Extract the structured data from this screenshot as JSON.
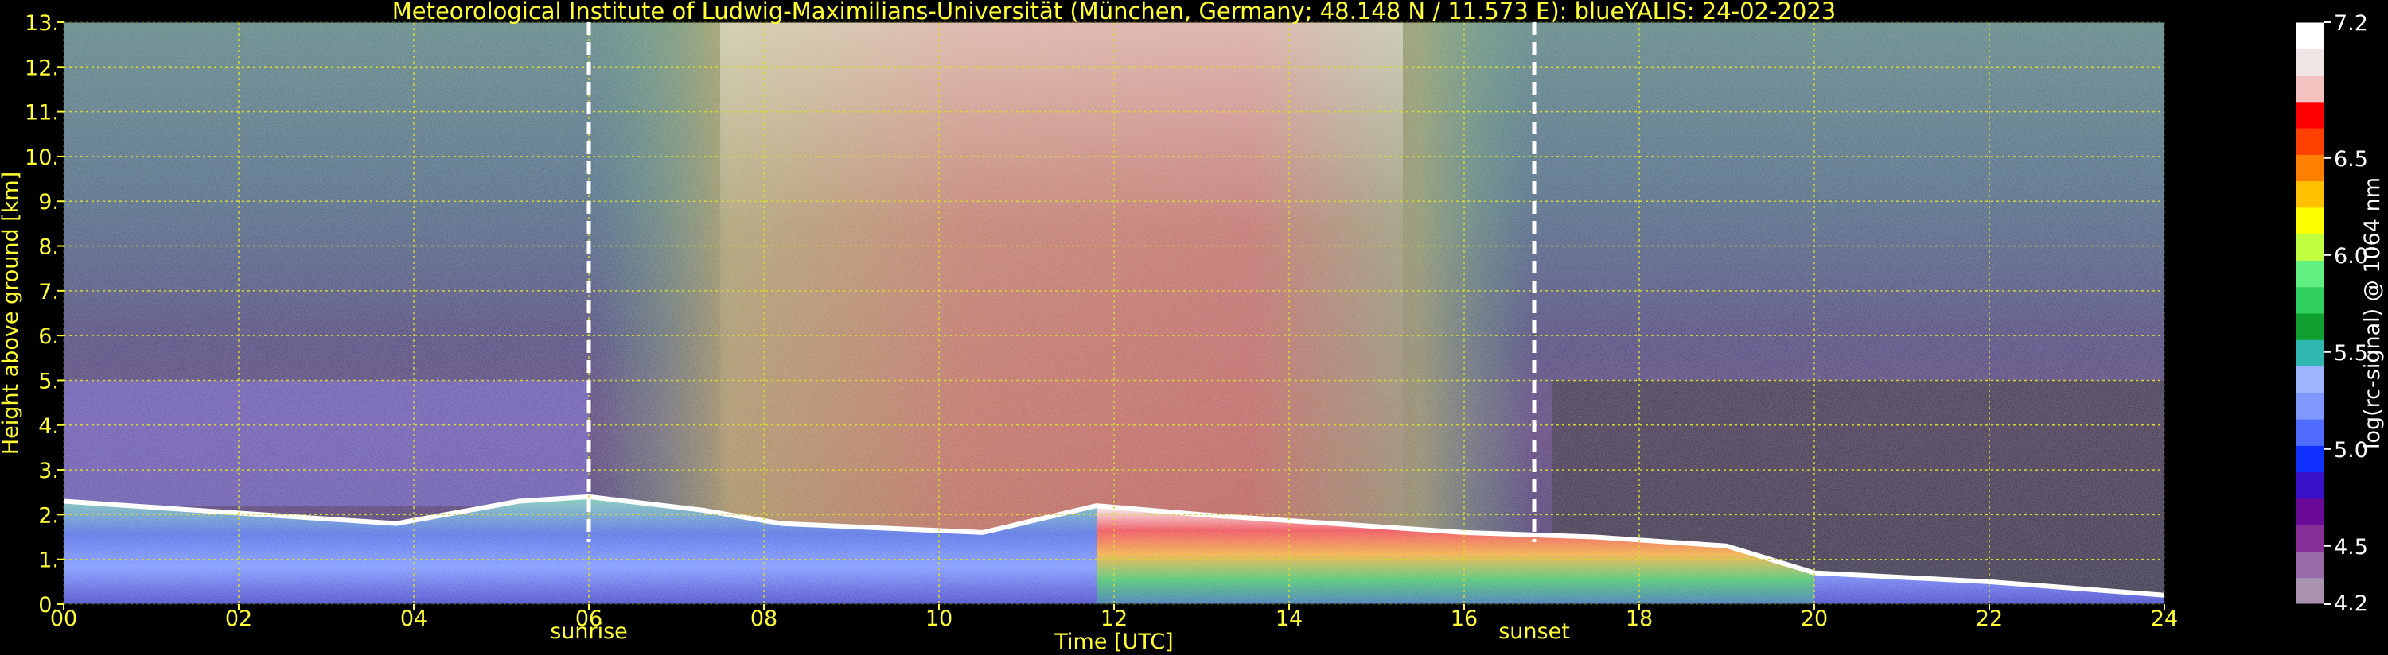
{
  "chart_data": {
    "type": "heatmap",
    "title": "Meteorological Institute of Ludwig-Maximilians-Universität (München, Germany; 48.148 N / 11.573 E):    blueYALIS: 24-02-2023",
    "xlabel": "Time [UTC]",
    "ylabel": "Height above ground [km]",
    "xlim": [
      0,
      24
    ],
    "ylim": [
      0,
      13
    ],
    "x_ticks": [
      0,
      2,
      4,
      6,
      8,
      10,
      12,
      14,
      16,
      18,
      20,
      22,
      24
    ],
    "x_tick_labels": [
      "00",
      "02",
      "04",
      "06",
      "08",
      "10",
      "12",
      "14",
      "16",
      "18",
      "20",
      "22",
      "24"
    ],
    "y_ticks": [
      0,
      1,
      2,
      3,
      4,
      5,
      6,
      7,
      8,
      9,
      10,
      11,
      12,
      13
    ],
    "y_tick_labels": [
      "0.",
      "1.",
      "2.",
      "3.",
      "4.",
      "5.",
      "6.",
      "7.",
      "8.",
      "9.",
      "10.",
      "11.",
      "12.",
      "13."
    ],
    "grid": true,
    "colorbar": {
      "label": "log(rc-signal) @ 1064 nm",
      "range": [
        4.2,
        7.2
      ],
      "ticks": [
        4.2,
        4.5,
        5.0,
        5.5,
        6.0,
        6.5,
        7.2
      ],
      "tick_labels": [
        "4.2",
        "4.5",
        "5.0",
        "5.5",
        "6.0",
        "6.5",
        "7.2"
      ],
      "colors": [
        "#a892b0",
        "#986aa8",
        "#88309a",
        "#6a0a96",
        "#3a10c8",
        "#1030ff",
        "#4f6cff",
        "#7f98ff",
        "#9fb4ff",
        "#30b8b0",
        "#10a030",
        "#30d060",
        "#60f080",
        "#c0ff40",
        "#ffff00",
        "#ffc000",
        "#ff8000",
        "#ff4000",
        "#ff0000",
        "#f4c0c0",
        "#f0e4e4",
        "#ffffff"
      ]
    },
    "events": [
      {
        "label": "sunrise",
        "time": 6.0
      },
      {
        "label": "sunset",
        "time": 16.8
      }
    ],
    "cloud_base_km": [
      {
        "time": 0.0,
        "height": 2.3
      },
      {
        "time": 1.5,
        "height": 2.1
      },
      {
        "time": 3.8,
        "height": 1.8
      },
      {
        "time": 5.2,
        "height": 2.3
      },
      {
        "time": 6.0,
        "height": 2.4
      },
      {
        "time": 7.3,
        "height": 2.1
      },
      {
        "time": 8.2,
        "height": 1.8
      },
      {
        "time": 10.5,
        "height": 1.6
      },
      {
        "time": 11.8,
        "height": 2.2
      },
      {
        "time": 13.0,
        "height": 2.0
      },
      {
        "time": 14.5,
        "height": 1.8
      },
      {
        "time": 16.0,
        "height": 1.6
      },
      {
        "time": 17.5,
        "height": 1.5
      },
      {
        "time": 19.0,
        "height": 1.3
      },
      {
        "time": 20.0,
        "height": 0.7
      },
      {
        "time": 22.0,
        "height": 0.5
      },
      {
        "time": 24.0,
        "height": 0.2
      }
    ]
  }
}
